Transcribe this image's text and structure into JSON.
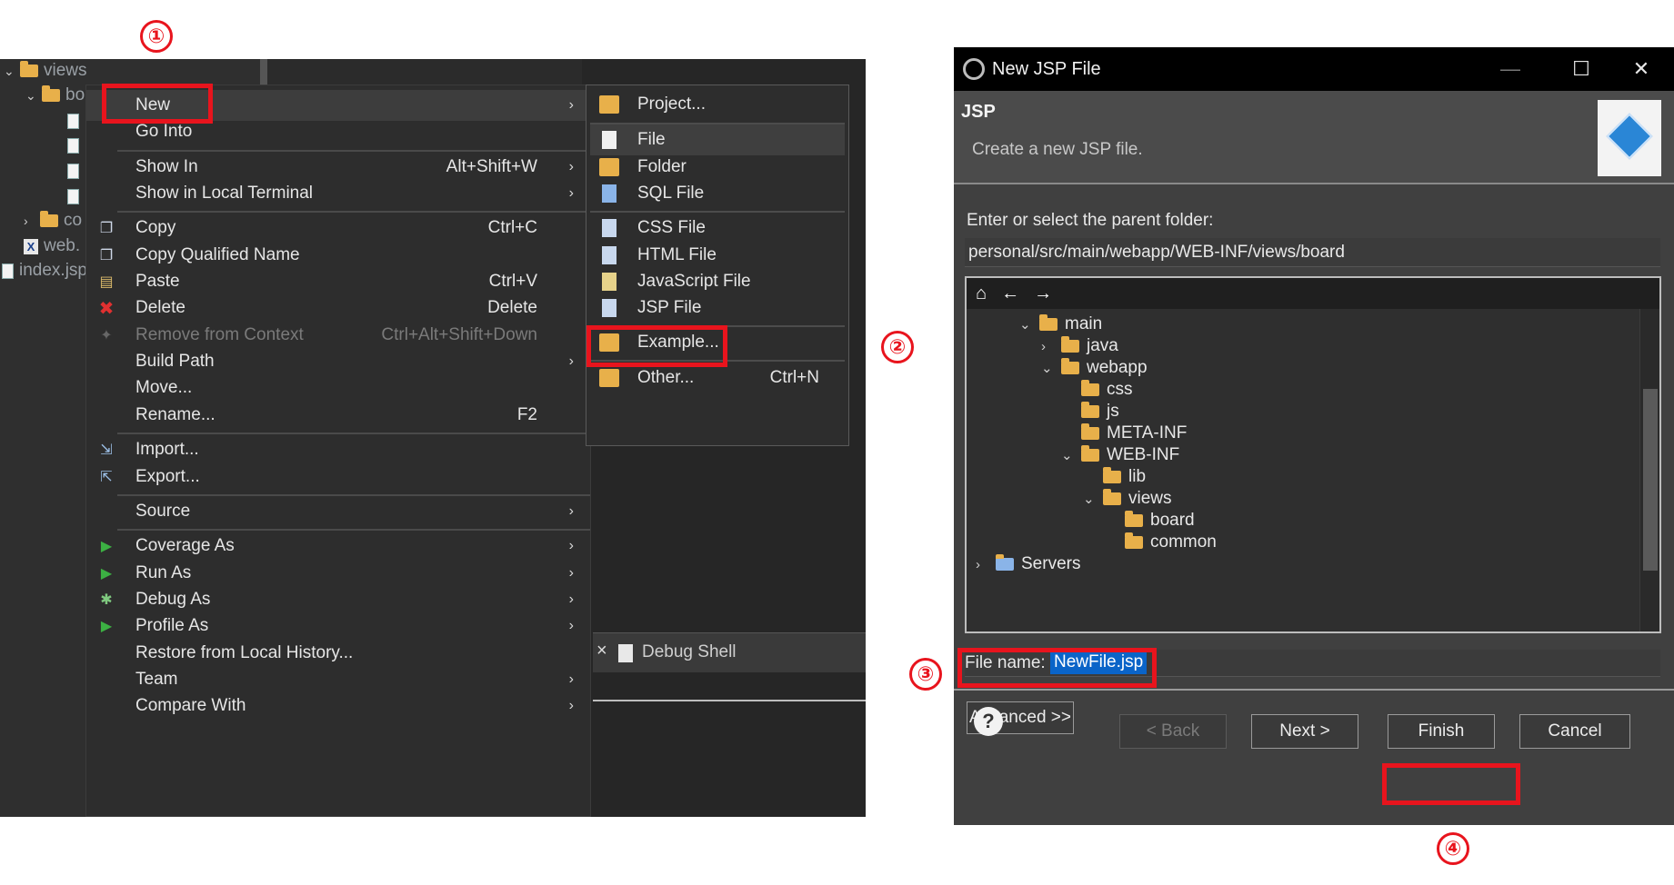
{
  "annotations": {
    "step1": "①",
    "step2": "②",
    "step3": "③",
    "step4": "④"
  },
  "explorer": {
    "items": [
      "views",
      "bo",
      "co",
      "web.",
      "index.jsp"
    ]
  },
  "context_menu": {
    "items": [
      {
        "label": "New",
        "arrow": "›"
      },
      {
        "label": "Go Into"
      },
      {
        "label": "Show In",
        "accel": "Alt+Shift+W",
        "arrow": "›"
      },
      {
        "label": "Show in Local Terminal",
        "arrow": "›"
      },
      {
        "label": "Copy",
        "accel": "Ctrl+C"
      },
      {
        "label": "Copy Qualified Name"
      },
      {
        "label": "Paste",
        "accel": "Ctrl+V"
      },
      {
        "label": "Delete",
        "accel": "Delete"
      },
      {
        "label": "Remove from Context",
        "accel": "Ctrl+Alt+Shift+Down"
      },
      {
        "label": "Build Path",
        "arrow": "›"
      },
      {
        "label": "Move..."
      },
      {
        "label": "Rename...",
        "accel": "F2"
      },
      {
        "label": "Import..."
      },
      {
        "label": "Export..."
      },
      {
        "label": "Source",
        "arrow": "›"
      },
      {
        "label": "Coverage As",
        "arrow": "›"
      },
      {
        "label": "Run As",
        "arrow": "›"
      },
      {
        "label": "Debug As",
        "arrow": "›"
      },
      {
        "label": "Profile As",
        "arrow": "›"
      },
      {
        "label": "Restore from Local History..."
      },
      {
        "label": "Team",
        "arrow": "›"
      },
      {
        "label": "Compare With",
        "arrow": "›"
      }
    ]
  },
  "submenu": {
    "items": [
      {
        "label": "Project..."
      },
      {
        "label": "File"
      },
      {
        "label": "Folder"
      },
      {
        "label": "SQL File"
      },
      {
        "label": "CSS File"
      },
      {
        "label": "HTML File"
      },
      {
        "label": "JavaScript File"
      },
      {
        "label": "JSP File"
      },
      {
        "label": "Example..."
      },
      {
        "label": "Other...",
        "accel": "Ctrl+N"
      }
    ]
  },
  "debug_tab": {
    "close": "×",
    "label": "Debug Shell"
  },
  "dialog": {
    "title": "New JSP File",
    "window_buttons": {
      "minimize": "—",
      "maximize": "☐",
      "close": "✕"
    },
    "banner_title": "JSP",
    "banner_desc": "Create a new JSP file.",
    "folder_prompt": "Enter or select the parent folder:",
    "folder_value": "personal/src/main/webapp/WEB-INF/views/board",
    "tree": [
      {
        "label": "main"
      },
      {
        "label": "java"
      },
      {
        "label": "webapp"
      },
      {
        "label": "css"
      },
      {
        "label": "js"
      },
      {
        "label": "META-INF"
      },
      {
        "label": "WEB-INF"
      },
      {
        "label": "lib"
      },
      {
        "label": "views"
      },
      {
        "label": "board"
      },
      {
        "label": "common"
      },
      {
        "label": "Servers"
      }
    ],
    "filename_label": "File name:",
    "filename_value": "NewFile.jsp",
    "advanced_label": "Advanced >>",
    "buttons": {
      "back": "< Back",
      "next": "Next >",
      "finish": "Finish",
      "cancel": "Cancel",
      "help": "?"
    }
  }
}
